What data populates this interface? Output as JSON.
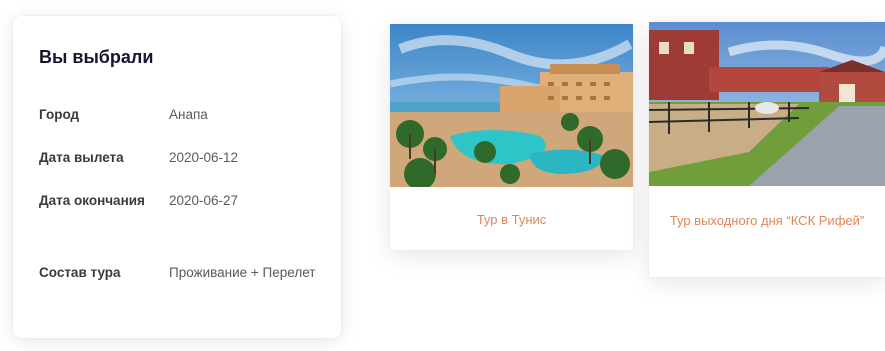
{
  "summary": {
    "title": "Вы выбрали",
    "rows": [
      {
        "label": "Город",
        "value": "Анапа"
      },
      {
        "label": "Дата вылета",
        "value": "2020-06-12"
      },
      {
        "label": "Дата окончания",
        "value": "2020-06-27"
      },
      {
        "label": "Состав тура",
        "value": "Проживание + Перелет"
      }
    ]
  },
  "tours": [
    {
      "title": "Тур в Тунис",
      "image": "resort-pool-photo"
    },
    {
      "title": "Тур выходного дня “КСК Рифей”",
      "image": "equestrian-center-photo"
    }
  ],
  "colors": {
    "accent": "#e38557",
    "heading": "#1b1430"
  }
}
